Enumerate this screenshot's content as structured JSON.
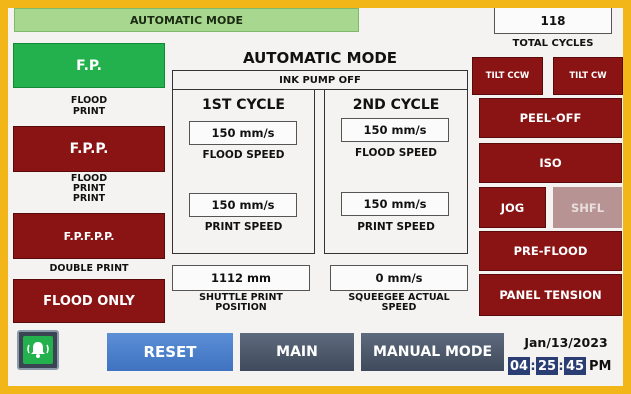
{
  "header": {
    "mode_bar": "AUTOMATIC MODE",
    "total_cycles_value": "118",
    "total_cycles_label": "TOTAL CYCLES"
  },
  "left": {
    "fp": "F.P.",
    "fp_caption": "FLOOD\nPRINT",
    "fpp": "F.P.P.",
    "fpp_caption": "FLOOD\nPRINT\nPRINT",
    "fpfpp": "F.P.F.P.P.",
    "fpfpp_caption": "DOUBLE PRINT",
    "flood_only": "FLOOD ONLY"
  },
  "center": {
    "title": "AUTOMATIC MODE",
    "ink_pump": "INK PUMP OFF",
    "cycle1": {
      "title": "1ST CYCLE",
      "flood_value": "150 mm/s",
      "flood_label": "FLOOD SPEED",
      "print_value": "150 mm/s",
      "print_label": "PRINT SPEED"
    },
    "cycle2": {
      "title": "2ND CYCLE",
      "flood_value": "150 mm/s",
      "flood_label": "FLOOD SPEED",
      "print_value": "150 mm/s",
      "print_label": "PRINT SPEED"
    },
    "shuttle_value": "1112 mm",
    "shuttle_label": "SHUTTLE PRINT\nPOSITION",
    "squeegee_value": "0 mm/s",
    "squeegee_label": "SQUEEGEE ACTUAL\nSPEED"
  },
  "right": {
    "tilt_ccw": "TILT CCW",
    "tilt_cw": "TILT CW",
    "peel_off": "PEEL-OFF",
    "iso": "ISO",
    "jog": "JOG",
    "shfl": "SHFL",
    "pre_flood": "PRE-FLOOD",
    "panel_tension": "PANEL TENSION"
  },
  "footer": {
    "reset": "RESET",
    "main": "MAIN",
    "manual_mode": "MANUAL MODE",
    "date": "Jan/13/2023",
    "hour": "04",
    "minute": "25",
    "second": "45",
    "ampm": "PM"
  },
  "colors": {
    "frame": "#f2b619",
    "red_button": "#8a1414",
    "green_button": "#23b14d",
    "mode_bar": "#a8d88f"
  }
}
